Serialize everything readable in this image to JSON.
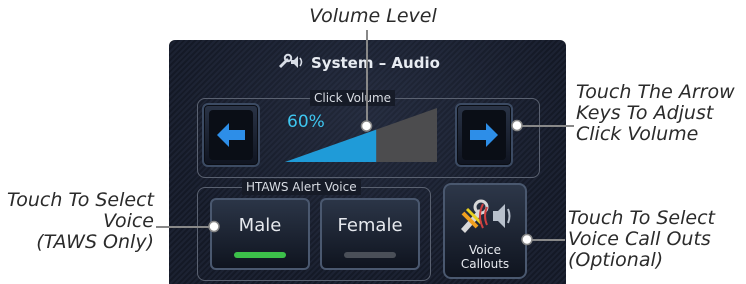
{
  "callouts": {
    "volume_level": "Volume Level",
    "arrow_keys": [
      "Touch The Arrow",
      "Keys To Adjust",
      "Click Volume"
    ],
    "select_voice": [
      "Touch To Select",
      "Voice",
      "(TAWS Only)"
    ],
    "voice_callouts": [
      "Touch To Select",
      "Voice Call Outs",
      "(Optional)"
    ]
  },
  "screen": {
    "title": "System – Audio",
    "title_icon": "speaker-wrench-icon",
    "click_volume": {
      "label": "Click Volume",
      "value_text": "60%",
      "level_fraction": 0.6,
      "decrease_icon": "arrow-left-icon",
      "increase_icon": "arrow-right-icon"
    },
    "htaws": {
      "label": "HTAWS Alert Voice",
      "options": [
        {
          "label": "Male",
          "selected": true
        },
        {
          "label": "Female",
          "selected": false
        }
      ]
    },
    "voice_callouts_button": {
      "lines": [
        "Voice",
        "Callouts"
      ],
      "icon": "wrench-speaker-icon"
    }
  },
  "colors": {
    "accent_cyan": "#2aa8e0",
    "selected_green": "#3cc04a",
    "unselected_gray": "#4a4f58",
    "arrow_blue": "#2d8ee8"
  }
}
